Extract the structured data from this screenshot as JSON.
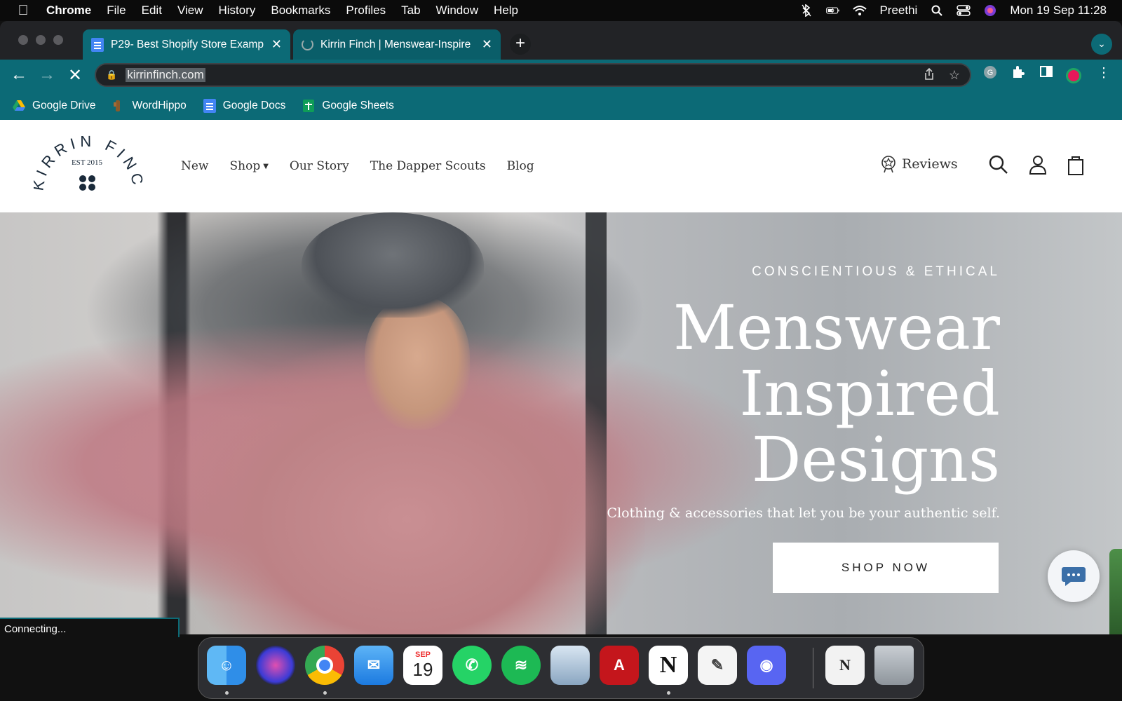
{
  "menubar": {
    "app": "Chrome",
    "items": [
      "File",
      "Edit",
      "View",
      "History",
      "Bookmarks",
      "Profiles",
      "Tab",
      "Window",
      "Help"
    ],
    "user": "Preethi",
    "datetime": "Mon 19 Sep  11:28"
  },
  "tabs": [
    {
      "title": "P29- Best Shopify Store Examp",
      "icon": "google-docs-icon"
    },
    {
      "title": "Kirrin Finch | Menswear-Inspire",
      "icon": "loading-spinner-icon"
    }
  ],
  "toolbar": {
    "url": "kirrinfinch.com"
  },
  "bookmarks": [
    {
      "label": "Google Drive",
      "icon": "google-drive-icon"
    },
    {
      "label": "WordHippo",
      "icon": "wordhippo-icon"
    },
    {
      "label": "Google Docs",
      "icon": "google-docs-icon"
    },
    {
      "label": "Google Sheets",
      "icon": "google-sheets-icon"
    }
  ],
  "site": {
    "logo": {
      "name": "KIRRIN FINCH",
      "est": "EST 2015"
    },
    "nav": [
      "New",
      "Shop",
      "Our Story",
      "The Dapper Scouts",
      "Blog"
    ],
    "reviews": "Reviews",
    "hero": {
      "eyebrow": "CONSCIENTIOUS & ETHICAL",
      "headline_lines": [
        "Menswear",
        "Inspired",
        "Designs"
      ],
      "subline": "Clothing & accessories that let you be your authentic self.",
      "cta": "SHOP NOW"
    }
  },
  "status": "Connecting...",
  "dock": [
    "Finder",
    "Siri",
    "Google Chrome",
    "Mail",
    "Calendar",
    "WhatsApp",
    "Spotify",
    "Preview",
    "Adobe Acrobat",
    "Notion",
    "TextEdit",
    "Discord",
    "Notion document",
    "Trash"
  ],
  "calendar": {
    "month": "SEP",
    "day": "19"
  }
}
